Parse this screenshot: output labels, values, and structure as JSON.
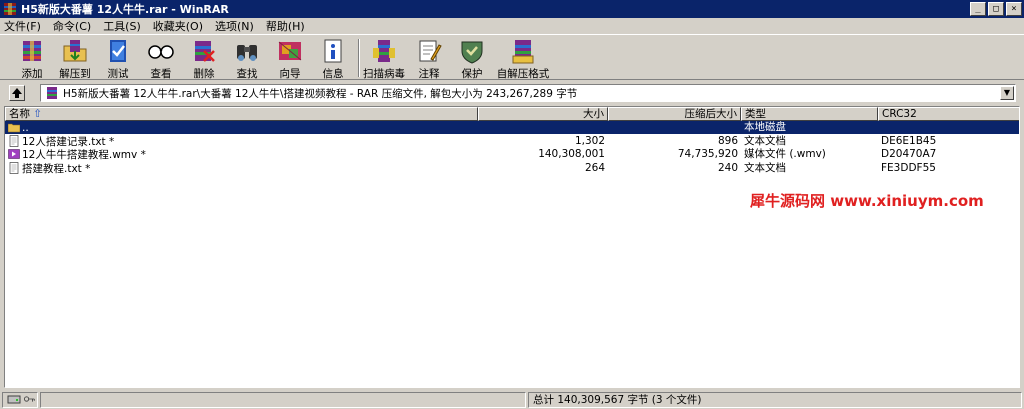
{
  "window": {
    "title": "H5新版大番薯 12人牛牛.rar - WinRAR",
    "min_symbol": "_",
    "max_symbol": "□",
    "close_symbol": "×"
  },
  "menu": [
    "文件(F)",
    "命令(C)",
    "工具(S)",
    "收藏夹(O)",
    "选项(N)",
    "帮助(H)"
  ],
  "toolbar": {
    "add": "添加",
    "extract_to": "解压到",
    "test": "测试",
    "view": "查看",
    "delete": "删除",
    "find": "查找",
    "wizard": "向导",
    "info": "信息",
    "scan_virus": "扫描病毒",
    "comment": "注释",
    "protect": "保护",
    "sfx": "自解压格式"
  },
  "path": {
    "text": "H5新版大番薯 12人牛牛.rar\\大番薯 12人牛牛\\搭建视频教程 - RAR 压缩文件, 解包大小为 243,267,289 字节"
  },
  "columns": {
    "name": "名称",
    "size": "大小",
    "packed": "压缩后大小",
    "type": "类型",
    "crc": "CRC32"
  },
  "rows": [
    {
      "name": "..",
      "size": "",
      "packed": "",
      "type": "本地磁盘",
      "crc": "",
      "icon": "folder-up-icon",
      "selected": true
    },
    {
      "name": "12人搭建记录.txt *",
      "size": "1,302",
      "packed": "896",
      "type": "文本文档",
      "crc": "DE6E1B45",
      "icon": "text-file-icon",
      "selected": false
    },
    {
      "name": "12人牛牛搭建教程.wmv *",
      "size": "140,308,001",
      "packed": "74,735,920",
      "type": "媒体文件 (.wmv)",
      "crc": "D20470A7",
      "icon": "video-file-icon",
      "selected": false
    },
    {
      "name": "搭建教程.txt *",
      "size": "264",
      "packed": "240",
      "type": "文本文档",
      "crc": "FE3DDF55",
      "icon": "text-file-icon",
      "selected": false
    }
  ],
  "watermark": "犀牛源码网 www.xiniuym.com",
  "status": {
    "total": "总计 140,309,567 字节 (3 个文件)"
  },
  "colors": {
    "titlebar": "#0a246a",
    "selection": "#0a246a",
    "watermark": "#e02020"
  }
}
